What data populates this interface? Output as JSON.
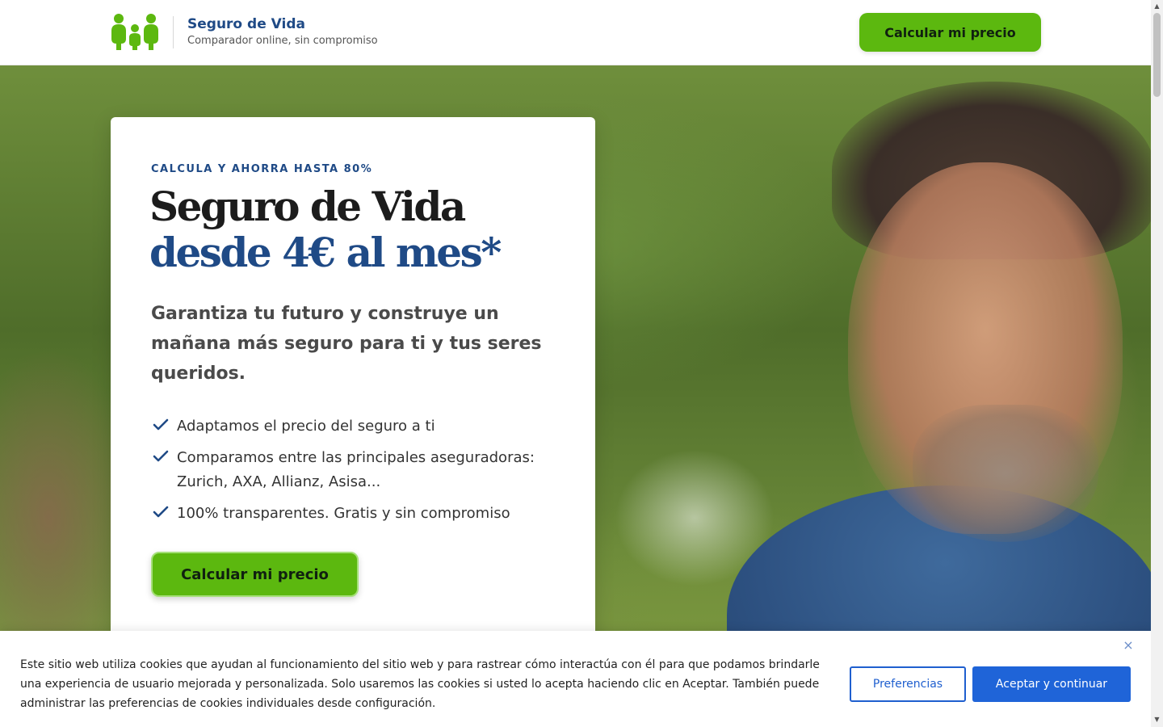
{
  "header": {
    "brand_title": "Seguro de Vida",
    "brand_subtitle": "Comparador online, sin compromiso",
    "cta_label": "Calcular mi precio",
    "logo_icon": "family-icon",
    "logo_color": "#5cb80f"
  },
  "hero": {
    "eyebrow": "CALCULA Y AHORRA HASTA 80%",
    "headline_part1": "Seguro de Vida ",
    "headline_accent": "desde 4€ al mes*",
    "lead": "Garantiza tu futuro y construye un mañana más seguro para ti y tus seres queridos.",
    "benefits": [
      "Adaptamos el precio del seguro a ti",
      "Comparamos entre las principales aseguradoras: Zurich, AXA, Allianz, Asisa...",
      "100% transparentes. Gratis y sin compromiso"
    ],
    "cta_label": "Calcular mi precio",
    "background_image": "smiling-man-in-park-photo"
  },
  "cookie_banner": {
    "text": "Este sitio web utiliza cookies que ayudan al funcionamiento del sitio web y para rastrear cómo interactúa con él para que podamos brindarle una experiencia de usuario mejorada y personalizada. Solo usaremos las cookies si usted lo acepta haciendo clic en Aceptar. También puede administrar las preferencias de cookies individuales desde configuración.",
    "preferences_label": "Preferencias",
    "accept_label": "Aceptar y continuar",
    "close_icon": "×"
  },
  "colors": {
    "brand_blue": "#1f4a86",
    "cta_green": "#5cb80f",
    "accept_blue": "#1f64d8"
  }
}
